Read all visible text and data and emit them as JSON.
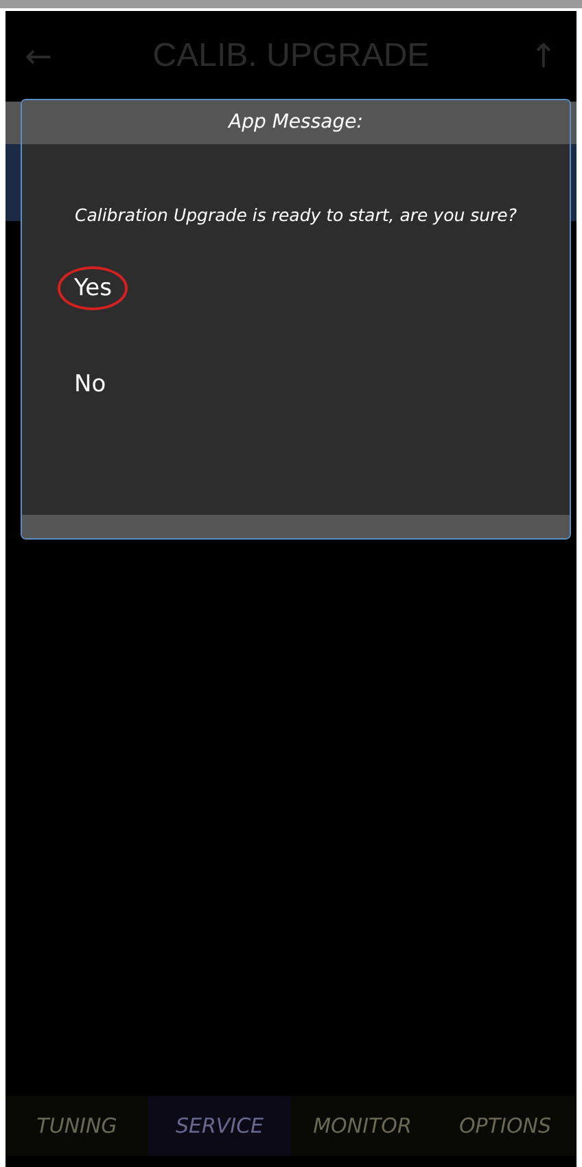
{
  "header": {
    "back_icon": "←",
    "title": "CALIB. UPGRADE",
    "up_icon": "↑"
  },
  "dialog": {
    "title": "App Message:",
    "message": "Calibration Upgrade is ready to start, are you sure?",
    "options": [
      {
        "label": "Yes",
        "highlighted": true
      },
      {
        "label": "No",
        "highlighted": false
      }
    ]
  },
  "bottom_nav": [
    {
      "label": "TUNING",
      "selected": false
    },
    {
      "label": "SERVICE",
      "selected": true
    },
    {
      "label": "MONITOR",
      "selected": false
    },
    {
      "label": "OPTIONS",
      "selected": false
    }
  ]
}
